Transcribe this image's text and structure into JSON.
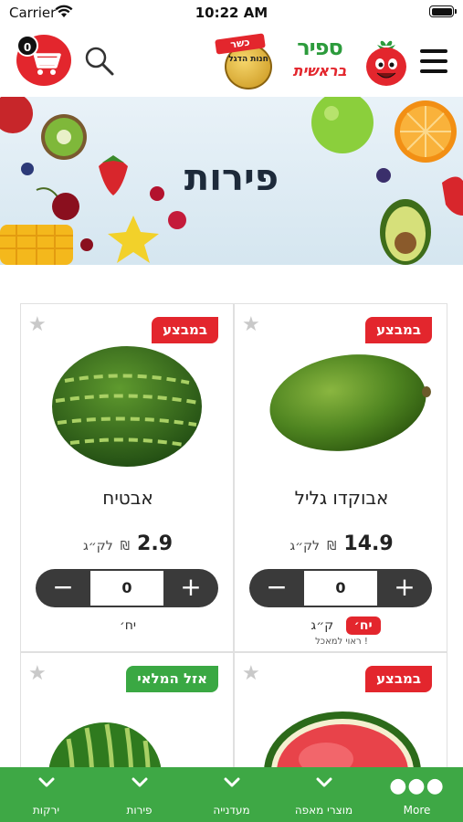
{
  "status_bar": {
    "carrier": "Carrier",
    "time": "10:22 AM"
  },
  "header": {
    "cart_count": "0",
    "kosher_label": "כשר",
    "seal_text": "חנות הדגל",
    "brand_main": "ספיר",
    "brand_sub": "בראשית"
  },
  "banner": {
    "title": "פירות"
  },
  "products": [
    {
      "name": "אבוקדו גליל",
      "badge": "במבצע",
      "price": "14.9",
      "currency": "₪",
      "per_unit": "לק״ג",
      "quantity": "0",
      "unit_options": [
        "יח׳",
        "ק״ג"
      ],
      "note": "ראוי למאכל !"
    },
    {
      "name": "אבטיח",
      "badge": "במבצע",
      "price": "2.9",
      "currency": "₪",
      "per_unit": "לק״ג",
      "quantity": "0",
      "unit_options": [
        "יח׳"
      ]
    },
    {
      "badge": "במבצע"
    },
    {
      "badge": "אזל המלאי"
    }
  ],
  "stepper": {
    "minus": "−",
    "plus": "+"
  },
  "bottom_nav": [
    {
      "label": "More",
      "icon": "more-dots-icon"
    },
    {
      "label": "מוצרי מאפה",
      "icon": "chevron-down-icon"
    },
    {
      "label": "מעדנייה",
      "icon": "chevron-down-icon"
    },
    {
      "label": "פירות",
      "icon": "chevron-down-icon"
    },
    {
      "label": "ירקות",
      "icon": "chevron-down-icon"
    }
  ],
  "colors": {
    "brand_red": "#e3262d",
    "brand_green": "#3ea845",
    "stepper_dark": "#3a3a3a"
  }
}
